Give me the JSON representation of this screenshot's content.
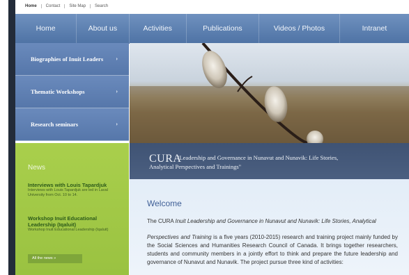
{
  "utility_nav": [
    "Home",
    "Contact",
    "Site Map",
    "Search"
  ],
  "main_nav": [
    "Home",
    "About us",
    "Activities",
    "Publications",
    "Videos / Photos",
    "Intranet"
  ],
  "side_menu": [
    "Biographies of Inuit Leaders",
    "Thematic Workshops",
    "Research seminars"
  ],
  "cura": {
    "title": "CURA",
    "quote_line1": "\"Leadership and Governance in Nunavut and Nunavik: Life Stories,",
    "quote_line2": "Analytical Perspectives and Trainings\""
  },
  "news": {
    "title": "News",
    "items": [
      {
        "head": "Interviews with Louis Tapardjuk",
        "body": "Interviews with Louis Tapardjuk are led in Laval University from Oct. 10 to 14."
      },
      {
        "head": "Workshop Inuit Educational Leadership (Iqaluit)",
        "body": "Workshop Inuit Educational Leadership (Iqaluit)"
      }
    ],
    "all_news": "All the news »"
  },
  "content": {
    "welcome": "Welcome",
    "line1_prefix": "The CURA ",
    "line1_italic": "Inuit Leadership and Governance in Nunavut and Nunavik: Life Stories, Analytical",
    "para_italic": "Perspectives and Training",
    "para_rest": " is a five years (2010-2015) research and training project mainly funded by the Social Sciences and Humanities Research Council of Canada. It brings together researchers, students and community members in a jointly effort to think and prepare the future leadership and governance of Nunavut and Nunavik. The project pursue three kind of activities:"
  },
  "colors": {
    "nav_blue": "#5b7db0",
    "side_blue": "#6283b6",
    "news_green": "#a3c948",
    "band_navy": "#42567a"
  }
}
